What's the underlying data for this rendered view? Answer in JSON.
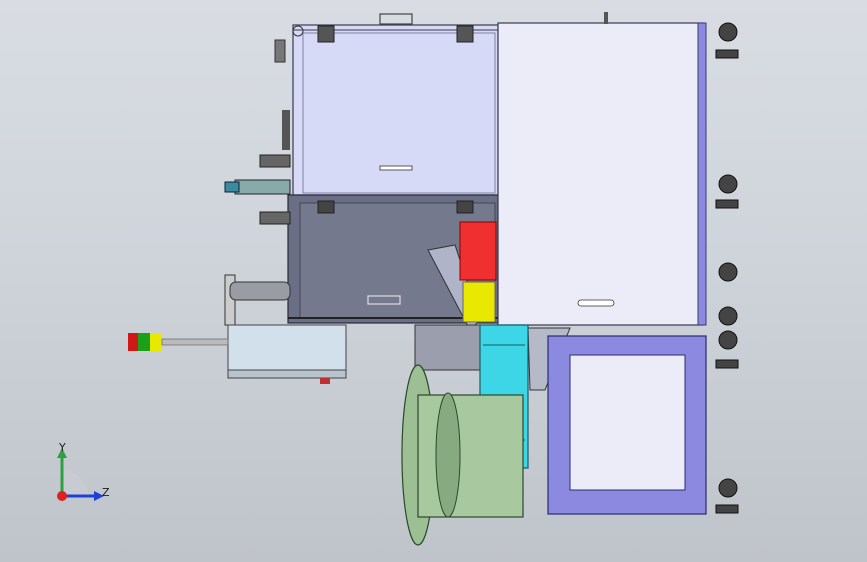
{
  "view": {
    "background_top": "#d9dde3",
    "background_bottom": "#bfc4ca"
  },
  "colors": {
    "upper_cabinet": "#d7daf7",
    "lower_cabinet": "#6a6f85",
    "right_panel": "#ececf8",
    "frame": "#8c8ae0",
    "cyan_block": "#3cd6e6",
    "red_part": "#f03030",
    "yellow_part": "#e8e800",
    "green_wheel": "#9dbf94",
    "light_box": "#d2e0ec"
  },
  "triad": {
    "y_label": "Y",
    "z_label": "Z",
    "y_color": "#2ea040",
    "z_color": "#1c40d8",
    "x_color": "#e02020"
  },
  "icons": [
    "signal-tower-icon",
    "caster-wheel-icon",
    "coordinate-triad-icon"
  ]
}
